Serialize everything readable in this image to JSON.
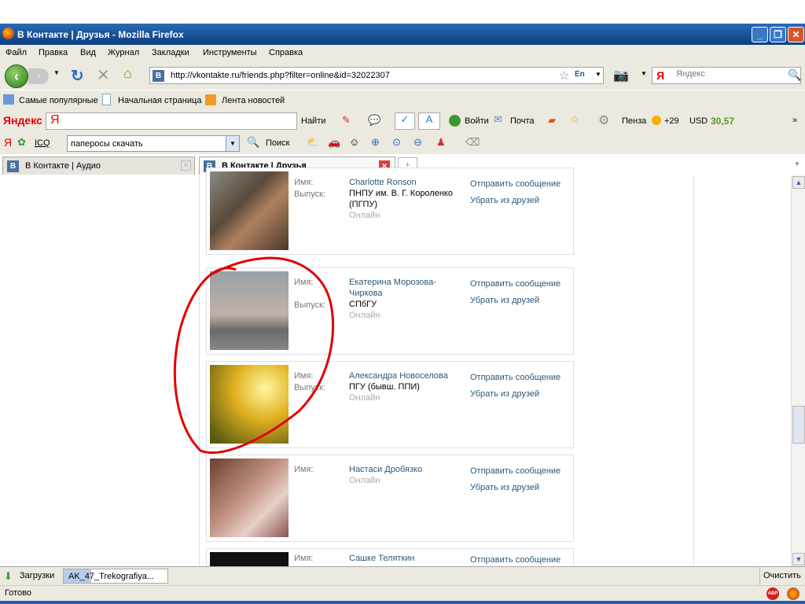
{
  "window": {
    "title": "В Контакте | Друзья - Mozilla Firefox"
  },
  "menu": [
    "Файл",
    "Правка",
    "Вид",
    "Журнал",
    "Закладки",
    "Инструменты",
    "Справка"
  ],
  "nav": {
    "url": "http://vkontakte.ru/friends.php?filter=online&id=32022307",
    "lang": "En",
    "search_placeholder": "Яндекс",
    "search_engine": "Я"
  },
  "bookmarks": [
    "Самые популярные",
    "Начальная страница",
    "Лента новостей"
  ],
  "yandex_bar": {
    "brand": "Яндекс",
    "logo": "Я",
    "find": "Найти",
    "login": "Войти",
    "mail": "Почта",
    "city": "Пенза",
    "temp": "+29",
    "currency": "USD",
    "rate": "30,57",
    "more": "»"
  },
  "toolbar2": {
    "logo": "Я",
    "icq": "ICQ",
    "query": "папеpосы  скачать",
    "search": "Поиск"
  },
  "tabs": [
    {
      "label": "В Контакте | Аудио"
    },
    {
      "label": "В Контакте | Друзья",
      "active": true
    }
  ],
  "labels": {
    "name": "Имя:",
    "graduation": "Выпуск:",
    "online": "Онлайн",
    "send": "Отправить сообщение",
    "remove": "Убрать из друзей"
  },
  "friends": [
    {
      "name": "Charlotte Ronson",
      "graduation": "ПНПУ им. В. Г. Короленко (ПГПУ)",
      "online": true
    },
    {
      "name": "Екатерина Морозова-Чиркова",
      "graduation": "СПбГУ",
      "online": true
    },
    {
      "name": "Александра Новоселова",
      "graduation": "ПГУ (бывш. ППИ)",
      "online": true
    },
    {
      "name": "Настаси Дробязко",
      "graduation": "",
      "online": true
    },
    {
      "name": "Сашке Теляткин",
      "graduation": "",
      "online": false
    }
  ],
  "downloads": {
    "label": "Загрузки",
    "item": "AK_47_Trekografiya...",
    "clear": "Очистить"
  },
  "status": {
    "text": "Готово",
    "abp": "ABP"
  },
  "colors": {
    "link": "#2b587a",
    "annotation": "#e00000"
  }
}
